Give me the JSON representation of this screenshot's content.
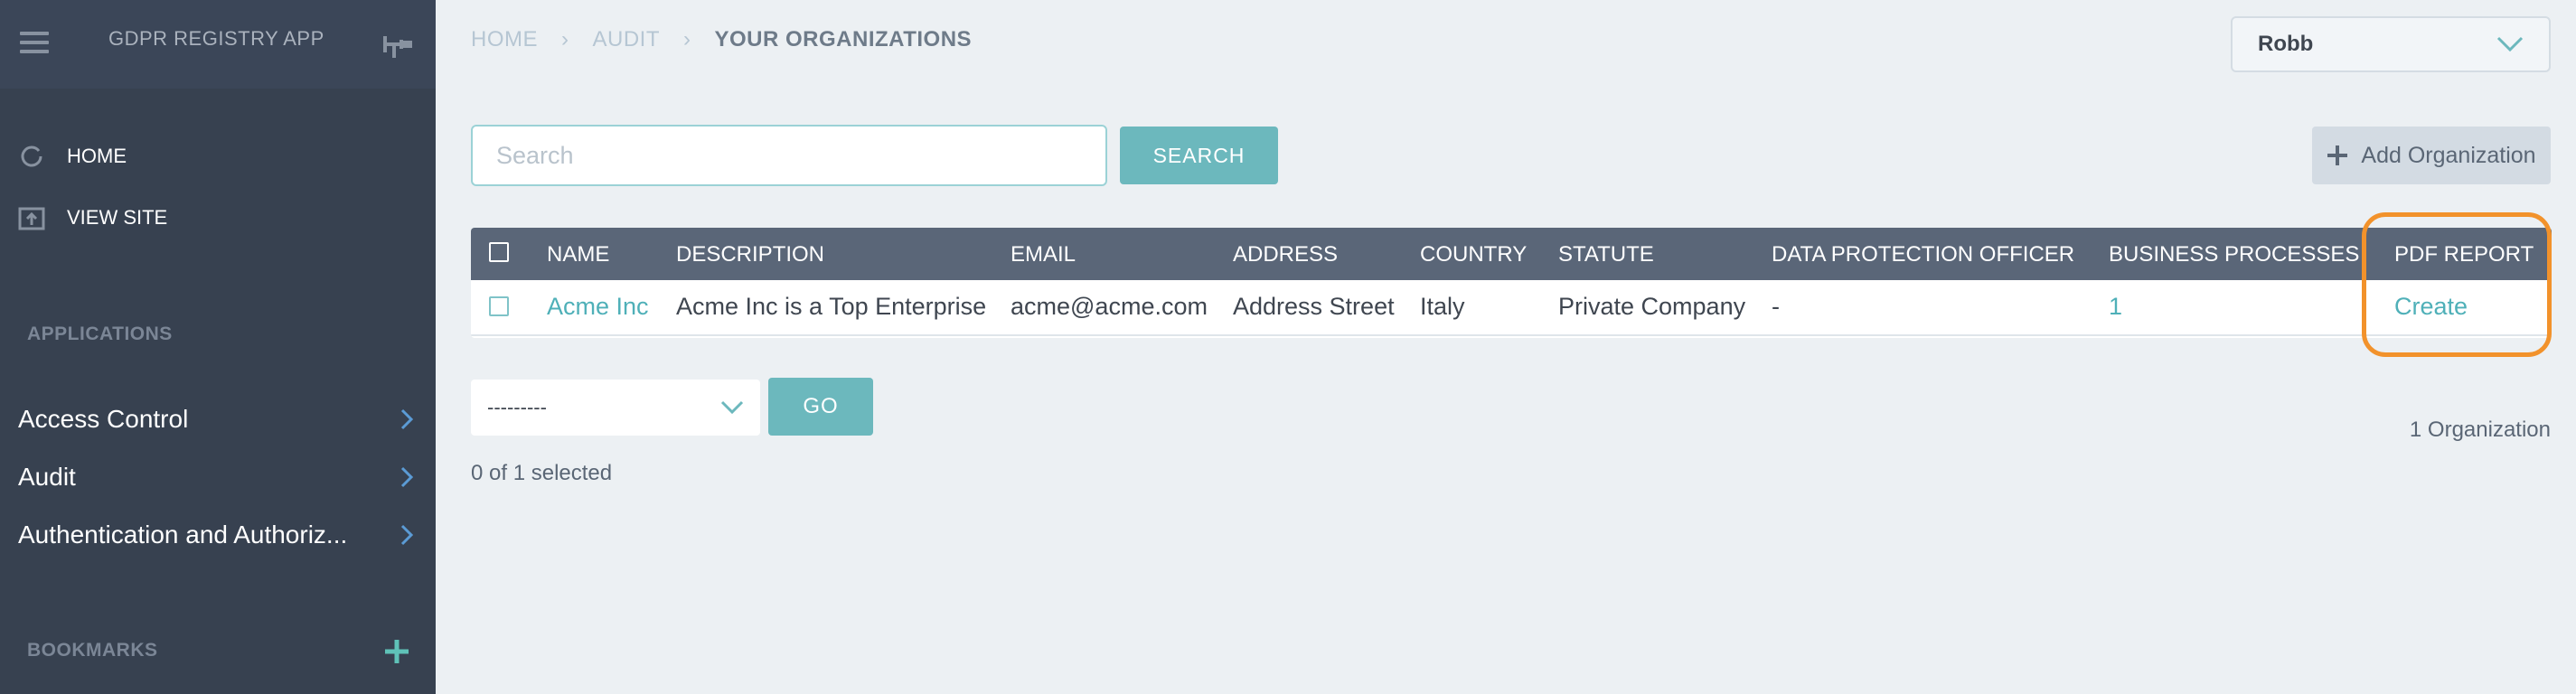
{
  "sidebar": {
    "app_title": "GDPR REGISTRY APP",
    "links": [
      {
        "label": "HOME",
        "icon": "circle-arrow-icon"
      },
      {
        "label": "VIEW SITE",
        "icon": "upload-box-icon"
      }
    ],
    "applications_label": "APPLICATIONS",
    "apps": [
      {
        "label": "Access Control"
      },
      {
        "label": "Audit"
      },
      {
        "label": "Authentication and Authoriz..."
      }
    ],
    "bookmarks_label": "BOOKMARKS"
  },
  "breadcrumb": [
    "HOME",
    "AUDIT",
    "YOUR ORGANIZATIONS"
  ],
  "user": {
    "name": "Robb"
  },
  "search": {
    "placeholder": "Search",
    "value": "",
    "button_label": "SEARCH"
  },
  "add_button_label": "Add Organization",
  "table": {
    "columns": [
      "NAME",
      "DESCRIPTION",
      "EMAIL",
      "ADDRESS",
      "COUNTRY",
      "STATUTE",
      "DATA PROTECTION OFFICER",
      "BUSINESS PROCESSES",
      "PDF REPORT"
    ],
    "rows": [
      [
        "Acme Inc",
        "Acme Inc is a Top Enterprise",
        "acme@acme.com",
        "Address Street",
        "Italy",
        "Private Company",
        "-",
        "1",
        "Create"
      ]
    ]
  },
  "actions": {
    "select_value": "---------",
    "go_label": "GO"
  },
  "selected_text": "0 of 1 selected",
  "count_text": "1 Organization",
  "colors": {
    "accent": "#6cb8bd",
    "highlight": "#f2922b",
    "sidebar": "#374150",
    "table_header": "#5a6678"
  }
}
